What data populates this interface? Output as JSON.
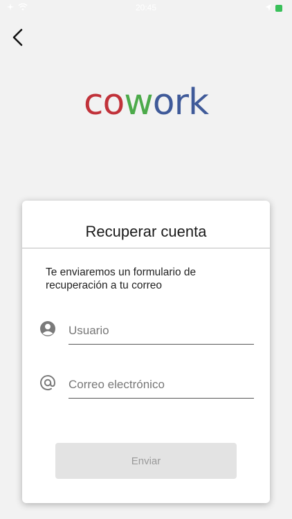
{
  "status_bar": {
    "time": "20:45"
  },
  "header": {
    "back_icon": "chevron-left-icon"
  },
  "logo": {
    "letters": [
      {
        "char": "c",
        "color": "#c1323a"
      },
      {
        "char": "o",
        "color": "#c1323a"
      },
      {
        "char": "w",
        "color": "#4caa4a"
      },
      {
        "char": "o",
        "color": "#3f5a99"
      },
      {
        "char": "r",
        "color": "#3f5a99"
      },
      {
        "char": "k",
        "color": "#3f5a99"
      }
    ]
  },
  "card": {
    "title": "Recuperar cuenta",
    "description": "Te enviaremos un formulario de recuperación a tu correo",
    "fields": {
      "username": {
        "placeholder": "Usuario",
        "icon": "account-circle-icon"
      },
      "email": {
        "placeholder": "Correo electrónico",
        "icon": "at-sign-icon"
      }
    },
    "submit_label": "Enviar"
  },
  "colors": {
    "background": "#f2f2f2",
    "card": "#ffffff",
    "button_disabled": "#e3e3e3",
    "button_text_disabled": "#9a9a9a"
  }
}
